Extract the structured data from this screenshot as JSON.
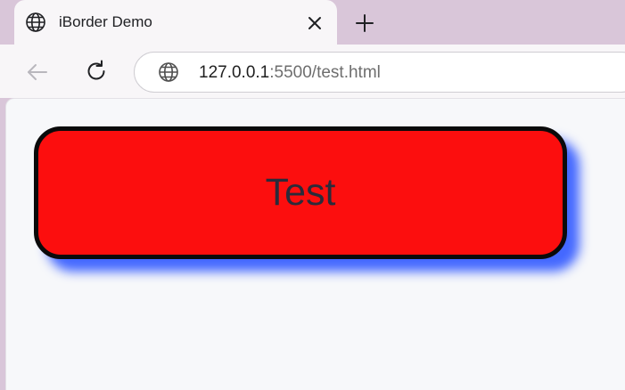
{
  "tab": {
    "title": "iBorder Demo",
    "icon": "globe-icon",
    "close_icon": "close-icon"
  },
  "new_tab_icon": "plus-icon",
  "toolbar": {
    "back_icon": "arrow-left-icon",
    "reload_icon": "reload-icon"
  },
  "address_bar": {
    "icon": "globe-icon",
    "host": "127.0.0.1",
    "rest": ":5500/test.html"
  },
  "page": {
    "button_label": "Test"
  },
  "colors": {
    "tabstrip_bg": "#d9c6d9",
    "button_bg": "#fc0e0e",
    "button_border": "#0a0a0a",
    "button_shadow": "#3a60ff",
    "page_bg": "#f7f8fa"
  }
}
